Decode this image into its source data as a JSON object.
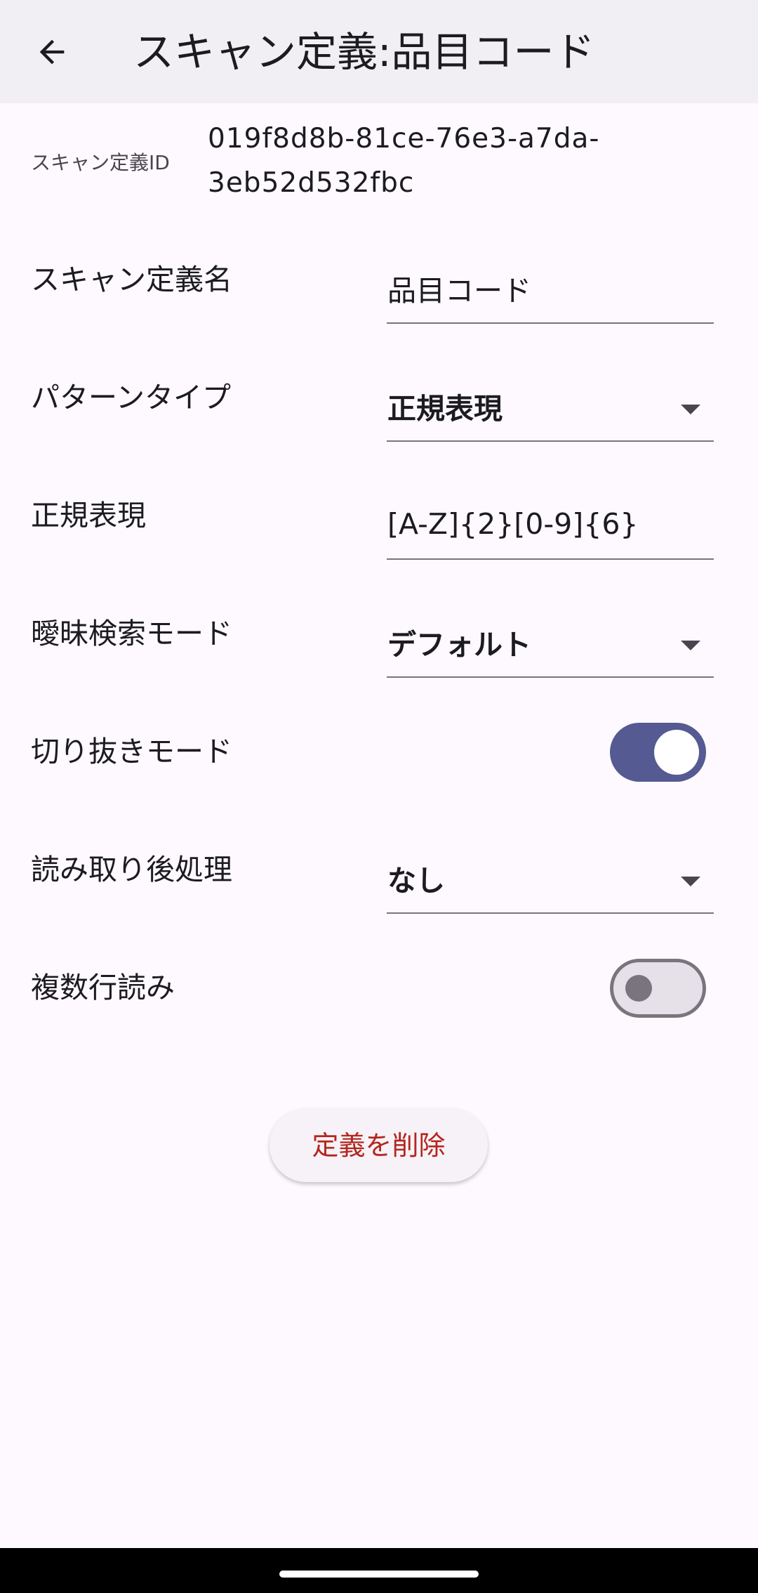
{
  "app_bar": {
    "title": "スキャン定義:品目コード",
    "back_icon": "arrow-back-icon"
  },
  "definition_id": {
    "label": "スキャン定義ID",
    "value": "019f8d8b-81ce-76e3-a7da-3eb52d532fbc"
  },
  "fields": {
    "name": {
      "label": "スキャン定義名",
      "value": "品目コード"
    },
    "pattern_type": {
      "label": "パターンタイプ",
      "value": "正規表現",
      "icon": "dropdown-arrow-icon"
    },
    "regex": {
      "label": "正規表現",
      "value": "[A-Z]{2}[0-9]{6}"
    },
    "fuzzy_mode": {
      "label": "曖昧検索モード",
      "value": "デフォルト",
      "icon": "dropdown-arrow-icon"
    },
    "crop_mode": {
      "label": "切り抜きモード",
      "enabled": true
    },
    "post_processing": {
      "label": "読み取り後処理",
      "value": "なし",
      "icon": "dropdown-arrow-icon"
    },
    "multiline": {
      "label": "複数行読み",
      "enabled": false
    }
  },
  "delete_button": {
    "label": "定義を削除"
  },
  "colors": {
    "app_bar_background": "#f1eff4",
    "page_background": "#fdf9fe",
    "switch_on_track": "#555a92",
    "switch_off_track": "#e6e1e9",
    "switch_outline": "#79747e",
    "danger_text": "#b3261e"
  }
}
